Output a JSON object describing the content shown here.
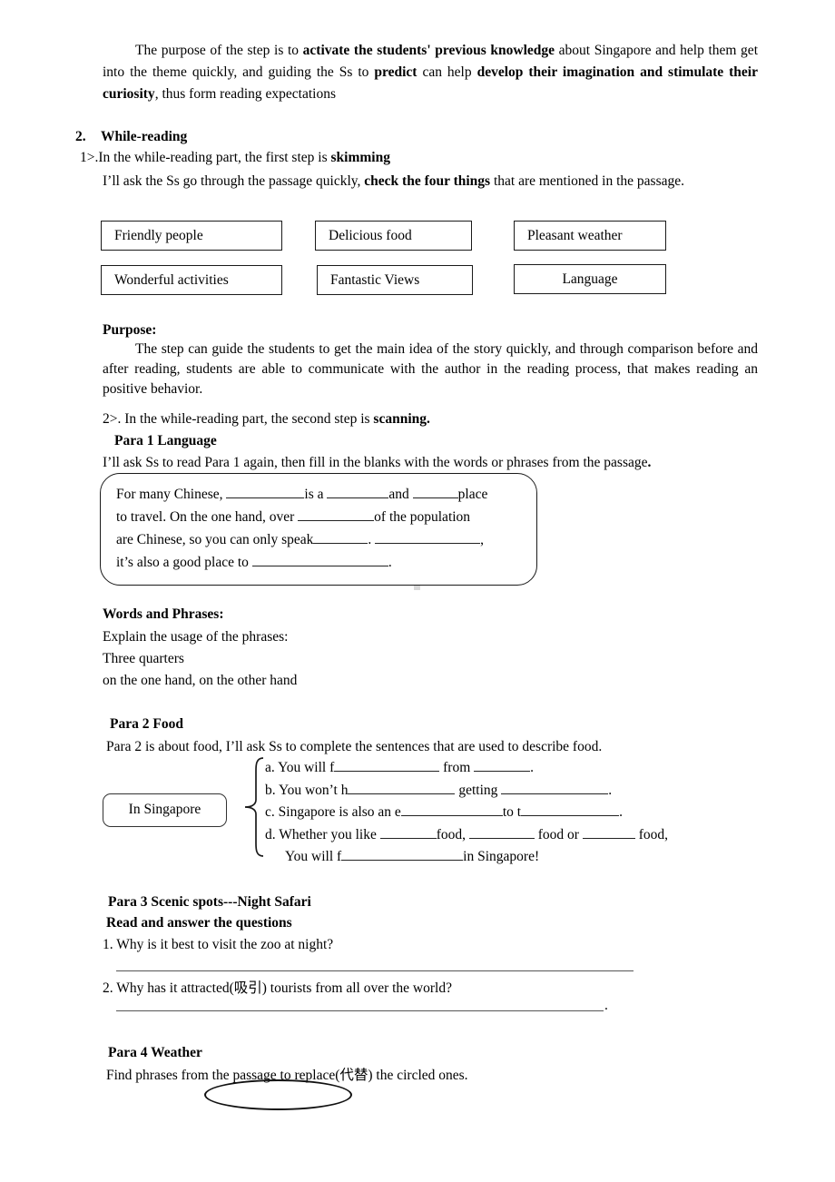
{
  "document": {
    "intro_paragraph": {
      "seg1": "The purpose of the step is to ",
      "bold1": "activate the students' previous knowledge",
      "seg2": " about Singapore and help them get into the theme quickly, and guiding the Ss to ",
      "bold2": "predict",
      "seg3": " can help ",
      "bold3": "develop their imagination and stimulate their curiosity",
      "seg4": ", thus form reading expectations"
    },
    "section": {
      "number": "2.",
      "title": "While-reading"
    },
    "step1": {
      "prefix": "1>.In the while-reading part, the first step is ",
      "bold": "skimming",
      "body_seg1": "I’ll ask the Ss go through the passage quickly, ",
      "body_bold": "check the four things",
      "body_seg2": " that are mentioned in the passage."
    },
    "skim_boxes": [
      {
        "label": "Friendly people",
        "align": "left"
      },
      {
        "label": "Delicious food",
        "align": "left"
      },
      {
        "label": "Pleasant weather",
        "align": "left"
      },
      {
        "label": "Wonderful activities",
        "align": "left"
      },
      {
        "label": "Fantastic Views",
        "align": "left"
      },
      {
        "label": "Language",
        "align": "center"
      }
    ],
    "purpose": {
      "label": "Purpose:",
      "body": "The step can guide the students to get the main idea of the story quickly, and through comparison before and after reading, students are able to communicate with the author in the reading process, that makes reading an positive behavior."
    },
    "step2": {
      "prefix": "2>. In the while-reading part, the second step is ",
      "bold": "scanning.",
      "para1_heading": "Para 1 Language",
      "para1_intro_seg1": "I’ll ask Ss to read Para 1 again, then fill in the blanks with the words or phrases from the passage",
      "para1_intro_bold": "."
    },
    "passage_box": {
      "line1_a": "For many Chinese,",
      "line1_b": "is a",
      "line1_c": "and",
      "line1_d": "place",
      "line2_a": "to travel. On the one hand, over",
      "line2_b": "of the population",
      "line3_a": "are Chinese, so you can only speak",
      "line3_b": ".",
      "line3_c": ",",
      "line4_a": "it’s also a good place to",
      "line4_b": "."
    },
    "words_and_phrases": {
      "heading": "Words and Phrases:",
      "line1": "Explain the usage of the phrases:",
      "line2": "Three quarters",
      "line3": "on the one hand, on the other hand"
    },
    "para2": {
      "heading": "Para 2 Food",
      "intro": "Para 2 is about food, I’ll ask Ss to complete the sentences that are used to describe food.",
      "box_label": "In Singapore",
      "items": [
        {
          "marker": "a.",
          "seg1": "You will f",
          "seg2": "from",
          "seg3": "."
        },
        {
          "marker": "b.",
          "seg1": "You won’t h",
          "seg2": "getting",
          "seg3": "."
        },
        {
          "marker": "c.",
          "seg1": "Singapore is also an e",
          "seg2": "to t",
          "seg3": "."
        },
        {
          "marker": "d.",
          "seg1": "Whether you like",
          "seg2": "food,",
          "seg3": "food or",
          "seg4": "food,"
        },
        {
          "marker": "",
          "seg1": "You will f",
          "seg2": "in Singapore!"
        }
      ]
    },
    "para3": {
      "heading": "Para 3    Scenic spots---Night Safari",
      "subheading": "Read and answer the questions",
      "question1": "1. Why is it best to visit the zoo at night?",
      "question2": "2. Why has it attracted(吸引) tourists from all over the world?",
      "answer2_trailing": "."
    },
    "para4": {
      "heading": "Para 4 Weather",
      "intro": "Find phrases from the passage to replace(代替) the circled ones.",
      "circled_content": ""
    }
  },
  "colors": {
    "text": "#000000",
    "box_border": "#1a1a1a",
    "rule": "#555555",
    "page_bg": "#ffffff"
  }
}
